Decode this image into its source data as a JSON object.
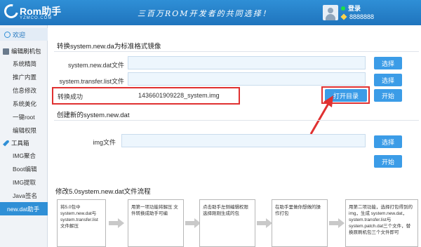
{
  "header": {
    "logo": "Rom助手",
    "logo_sub": "YZMCO.COM",
    "slogan": "三百万ROM开发者的共同选择！",
    "login": "登录",
    "vip_number": "8888888"
  },
  "sidebar": {
    "welcome": "欢迎",
    "group1": "编辑刷机包",
    "group1_items": [
      "系统精简",
      "推广内置",
      "信息修改",
      "系统美化",
      "一键root",
      "编辑权限"
    ],
    "group2": "工具箱",
    "group2_items": [
      "IMG聚合",
      "Boot编辑",
      "IMG提取",
      "Java签名",
      "new.dat助手"
    ]
  },
  "convert": {
    "title": "转换system.new.da为标准格式镜像",
    "dat_label": "system.new.dat文件",
    "dat_value": "",
    "list_label": "system.transfer.list文件",
    "list_value": "",
    "choose": "选择",
    "status_label": "转换成功",
    "status_value": "1436601909228_system.img",
    "open_dir": "打开目录",
    "start": "开始"
  },
  "create": {
    "title": "创建新的system.new.dat",
    "img_label": "img文件",
    "img_value": "",
    "choose": "选择",
    "start": "开始"
  },
  "flow": {
    "title": "修改5.0system.new.dat文件流程",
    "steps": [
      "将5.0包中 system.new.dat与 system.transfer.list 文件解压",
      "用第一项功能将解压 文件转换成助手可编",
      "点击助手左侧编辑权限 选择刚刚生成的包",
      "在助手里做你想做的操 作打包",
      "用第二项功能，选择打包得到的img，生成 system.new.dat，system.transfer.list与 system.patch.dat三个文件，替 换原刷机包三个文件即可"
    ]
  },
  "colors": {
    "header": "#2f8fd6",
    "button": "#3b9ce7",
    "highlight": "#e03131",
    "active_nav": "#2f8fd6"
  }
}
